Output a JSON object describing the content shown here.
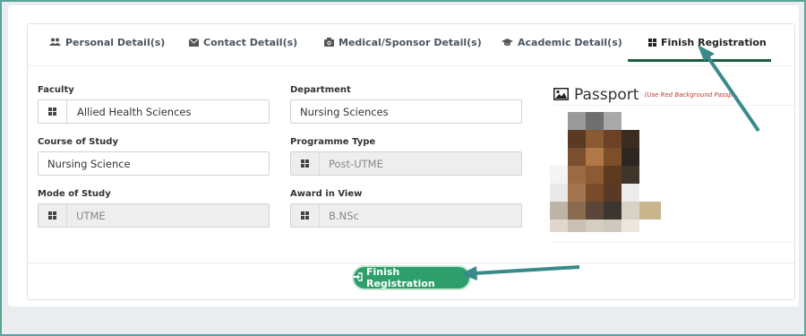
{
  "tabs": [
    {
      "label": "Personal Detail(s)",
      "icon": "users-icon"
    },
    {
      "label": "Contact Detail(s)",
      "icon": "envelope-icon"
    },
    {
      "label": "Medical/Sponsor Detail(s)",
      "icon": "camera-icon"
    },
    {
      "label": "Academic Detail(s)",
      "icon": "graduation-cap-icon"
    },
    {
      "label": "Finish Registration",
      "icon": "th-large-icon",
      "active": true
    }
  ],
  "form": {
    "faculty": {
      "label": "Faculty",
      "value": "Allied Health Sciences"
    },
    "department": {
      "label": "Department",
      "value": "Nursing Sciences"
    },
    "course": {
      "label": "Course of Study",
      "value": "Nursing Science"
    },
    "programme": {
      "label": "Programme Type",
      "value": "Post-UTME"
    },
    "mode": {
      "label": "Mode of Study",
      "value": "UTME"
    },
    "award": {
      "label": "Award in View",
      "value": "B.NSc"
    }
  },
  "passport": {
    "title": "Passport",
    "note": "(Use Red Background Passp..."
  },
  "finish_button": {
    "label": "Finish Registration"
  },
  "colors": {
    "accent_green": "#2e9e6b",
    "tab_underline": "#1b5e3c",
    "annotation_arrow": "#3a8a8a",
    "note_red": "#c0392b"
  }
}
